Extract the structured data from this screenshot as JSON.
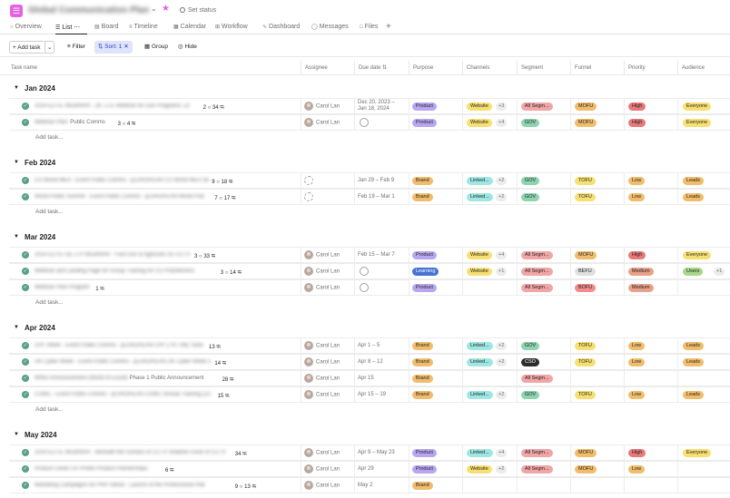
{
  "header": {
    "project_title": "Global Communication Plan",
    "set_status": "Set status"
  },
  "tabs": [
    {
      "label": "Overview",
      "icon": "overview-icon"
    },
    {
      "label": "List",
      "icon": "list-icon",
      "active": true
    },
    {
      "label": "Board",
      "icon": "board-icon"
    },
    {
      "label": "Timeline",
      "icon": "timeline-icon"
    },
    {
      "label": "Calendar",
      "icon": "calendar-icon"
    },
    {
      "label": "Workflow",
      "icon": "workflow-icon"
    },
    {
      "label": "Dashboard",
      "icon": "dashboard-icon"
    },
    {
      "label": "Messages",
      "icon": "messages-icon"
    },
    {
      "label": "Files",
      "icon": "files-icon"
    }
  ],
  "toolbar": {
    "add_task": "Add task",
    "filter": "Filter",
    "sort": "Sort: 1",
    "group": "Group",
    "hide": "Hide"
  },
  "columns": [
    "Task name",
    "Assignee",
    "Due date",
    "Purpose",
    "Channels",
    "Segment",
    "Funnel",
    "Priority",
    "Audience"
  ],
  "add_task_row": "Add task...",
  "colors": {
    "Product": "#b9a6f0",
    "Brand": "#f1bd6c",
    "Learning": "#4573d2",
    "Website": "#f8df72",
    "Linked...": "#9ee7e3",
    "All Segm...": "#f1a6a6",
    "GOV": "#8fd4b0",
    "CSO": "#2c2c2c",
    "MOFU": "#f1bd6c",
    "TOFU": "#f8df72",
    "BOFU": "#f38c8c",
    "High": "#e8787a",
    "Low": "#f1bd6c",
    "Medium": "#e9a189",
    "Everyone": "#f8df72",
    "Leads": "#f1bd6c",
    "Users": "#a8d889"
  },
  "sections": [
    {
      "name": "Jan 2024",
      "tasks": [
        {
          "name": "2024 ELITE WEBINAR - 2K: LTE Webinar for Gov Programs: Lit",
          "comments": "2",
          "subtasks": "34",
          "assignee": "Carol Lan",
          "due": "Dec 20, 2023 – Jan 18, 2024",
          "purpose": "Product",
          "channels": [
            "Website"
          ],
          "channels_more": "+3",
          "segment": "All Segm...",
          "funnel": "MOFU",
          "priority": "High",
          "audience": "Everyone",
          "audience_more": ""
        },
        {
          "name": "Webinar Plan: ",
          "suffix": "Public Comms",
          "comments": "3",
          "subtasks": "4",
          "assignee": "Carol Lan",
          "due": "",
          "purpose": "Product",
          "channels": [
            "Website"
          ],
          "channels_more": "+4",
          "segment": "GOV",
          "funnel": "MOFU",
          "priority": "High",
          "audience": "Everyone",
          "audience_more": ""
        }
      ]
    },
    {
      "name": "Feb 2024",
      "tasks": [
        {
          "name": "CS World MEA - Event Public Comms - [EUROPEAN CS World MEA Se",
          "comments": "9",
          "subtasks": "18",
          "assignee": "",
          "due": "Jan 29 – Feb 9",
          "purpose": "Brand",
          "channels": [
            "Linked..."
          ],
          "channels_more": "+2",
          "segment": "GOV",
          "funnel": "TOFU",
          "priority": "Low",
          "audience": "Leads",
          "audience_more": ""
        },
        {
          "name": "World Public Summit - Event Public Comms - [EUROPEAN World Pub",
          "comments": "7",
          "subtasks": "17",
          "assignee": "",
          "due": "Feb 19 – Mar 1",
          "purpose": "Brand",
          "channels": [
            "Linked..."
          ],
          "channels_more": "+2",
          "segment": "GOV",
          "funnel": "TOFU",
          "priority": "Low",
          "audience": "Leads",
          "audience_more": ""
        }
      ]
    },
    {
      "name": "Mar 2024",
      "tasks": [
        {
          "name": "2024 ELITE GE 170 WEBINAR - Fast Gov & Agencies 2E CCTV",
          "comments": "3",
          "subtasks": "33",
          "assignee": "Carol Lan",
          "due": "Feb 15 – Mar 7",
          "purpose": "Product",
          "channels": [
            "Website"
          ],
          "channels_more": "+4",
          "segment": "All Segm...",
          "funnel": "MOFU",
          "priority": "High",
          "audience": "Everyone",
          "audience_more": ""
        },
        {
          "name": "Webinar and Landing Page for Group Training for CS Practitioners",
          "comments": "3",
          "subtasks": "14",
          "assignee": "Carol Lan",
          "due": "",
          "purpose": "Learning",
          "channels": [
            "Website"
          ],
          "channels_more": "+1",
          "segment": "All Segm...",
          "funnel": "BEFU",
          "priority": "Medium",
          "audience": "Users",
          "audience_more": "+1"
        },
        {
          "name": "Webinar Pilot Program",
          "comments": "",
          "subtasks": "1",
          "assignee": "Carol Lan",
          "due": "",
          "purpose": "Product",
          "channels": [],
          "channels_more": "",
          "segment": "All Segm...",
          "funnel": "BOFU",
          "priority": "Medium",
          "audience": "",
          "audience_more": ""
        }
      ]
    },
    {
      "name": "Apr 2024",
      "tasks": [
        {
          "name": "CPF Week - Event Public Comms - [EUROPEAN CPF (TN TIM): Noto",
          "comments": "",
          "subtasks": "13",
          "assignee": "Carol Lan",
          "due": "Apr 1 – 5",
          "purpose": "Brand",
          "channels": [
            "Linked..."
          ],
          "channels_more": "+2",
          "segment": "GOV",
          "funnel": "TOFU",
          "priority": "Low",
          "audience": "Leads",
          "audience_more": ""
        },
        {
          "name": "UK Cyber Week - Event Public Comms - [EUROPEAN UK Cyber Week 5",
          "comments": "",
          "subtasks": "14",
          "assignee": "Carol Lan",
          "due": "Apr 8 – 12",
          "purpose": "Brand",
          "channels": [
            "Linked..."
          ],
          "channels_more": "+2",
          "segment": "CSO",
          "funnel": "TOFU",
          "priority": "Low",
          "audience": "Leads",
          "audience_more": ""
        },
        {
          "name": "WWD Announcement (World of Excell)",
          "suffix": "Phase 1 Public Announcement",
          "comments": "",
          "subtasks": "28",
          "assignee": "Carol Lan",
          "due": "Apr 15",
          "purpose": "Brand",
          "channels": [],
          "channels_more": "",
          "segment": "All Segm...",
          "funnel": "",
          "priority": "",
          "audience": "",
          "audience_more": ""
        },
        {
          "name": "CSWC - Event Public Comms - [EUROPEAN CSWC Annual Training (22-",
          "comments": "",
          "subtasks": "15",
          "assignee": "Carol Lan",
          "due": "Apr 15 – 19",
          "purpose": "Brand",
          "channels": [
            "Linked..."
          ],
          "channels_more": "+2",
          "segment": "GOV",
          "funnel": "TOFU",
          "priority": "Low",
          "audience": "Leads",
          "audience_more": ""
        }
      ]
    },
    {
      "name": "May 2024",
      "tasks": [
        {
          "name": "2024 ELITE WEBINAR - Beneath the Surface of CCTV Shadow Clock of CCTV",
          "comments": "",
          "subtasks": "34",
          "assignee": "Carol Lan",
          "due": "Apr 9 – May 23",
          "purpose": "Product",
          "channels": [
            "Linked..."
          ],
          "channels_more": "+4",
          "segment": "All Segm...",
          "funnel": "MOFU",
          "priority": "High",
          "audience": "Everyone",
          "audience_more": ""
        },
        {
          "name": "Product Clean UX Profile Product Partnerships",
          "comments": "",
          "subtasks": "6",
          "assignee": "Carol Lan",
          "due": "Apr 29",
          "purpose": "Product",
          "channels": [
            "Website"
          ],
          "channels_more": "+2",
          "segment": "All Segm...",
          "funnel": "MOFU",
          "priority": "Low",
          "audience": "",
          "audience_more": ""
        },
        {
          "name": "Marketing Campaigns for PHP rollout - Launch of the Professional Plat",
          "comments": "9",
          "subtasks": "13",
          "assignee": "Carol Lan",
          "due": "May 2",
          "purpose": "Brand",
          "channels": [],
          "channels_more": "",
          "segment": "",
          "funnel": "",
          "priority": "",
          "audience": "",
          "audience_more": ""
        }
      ]
    }
  ]
}
